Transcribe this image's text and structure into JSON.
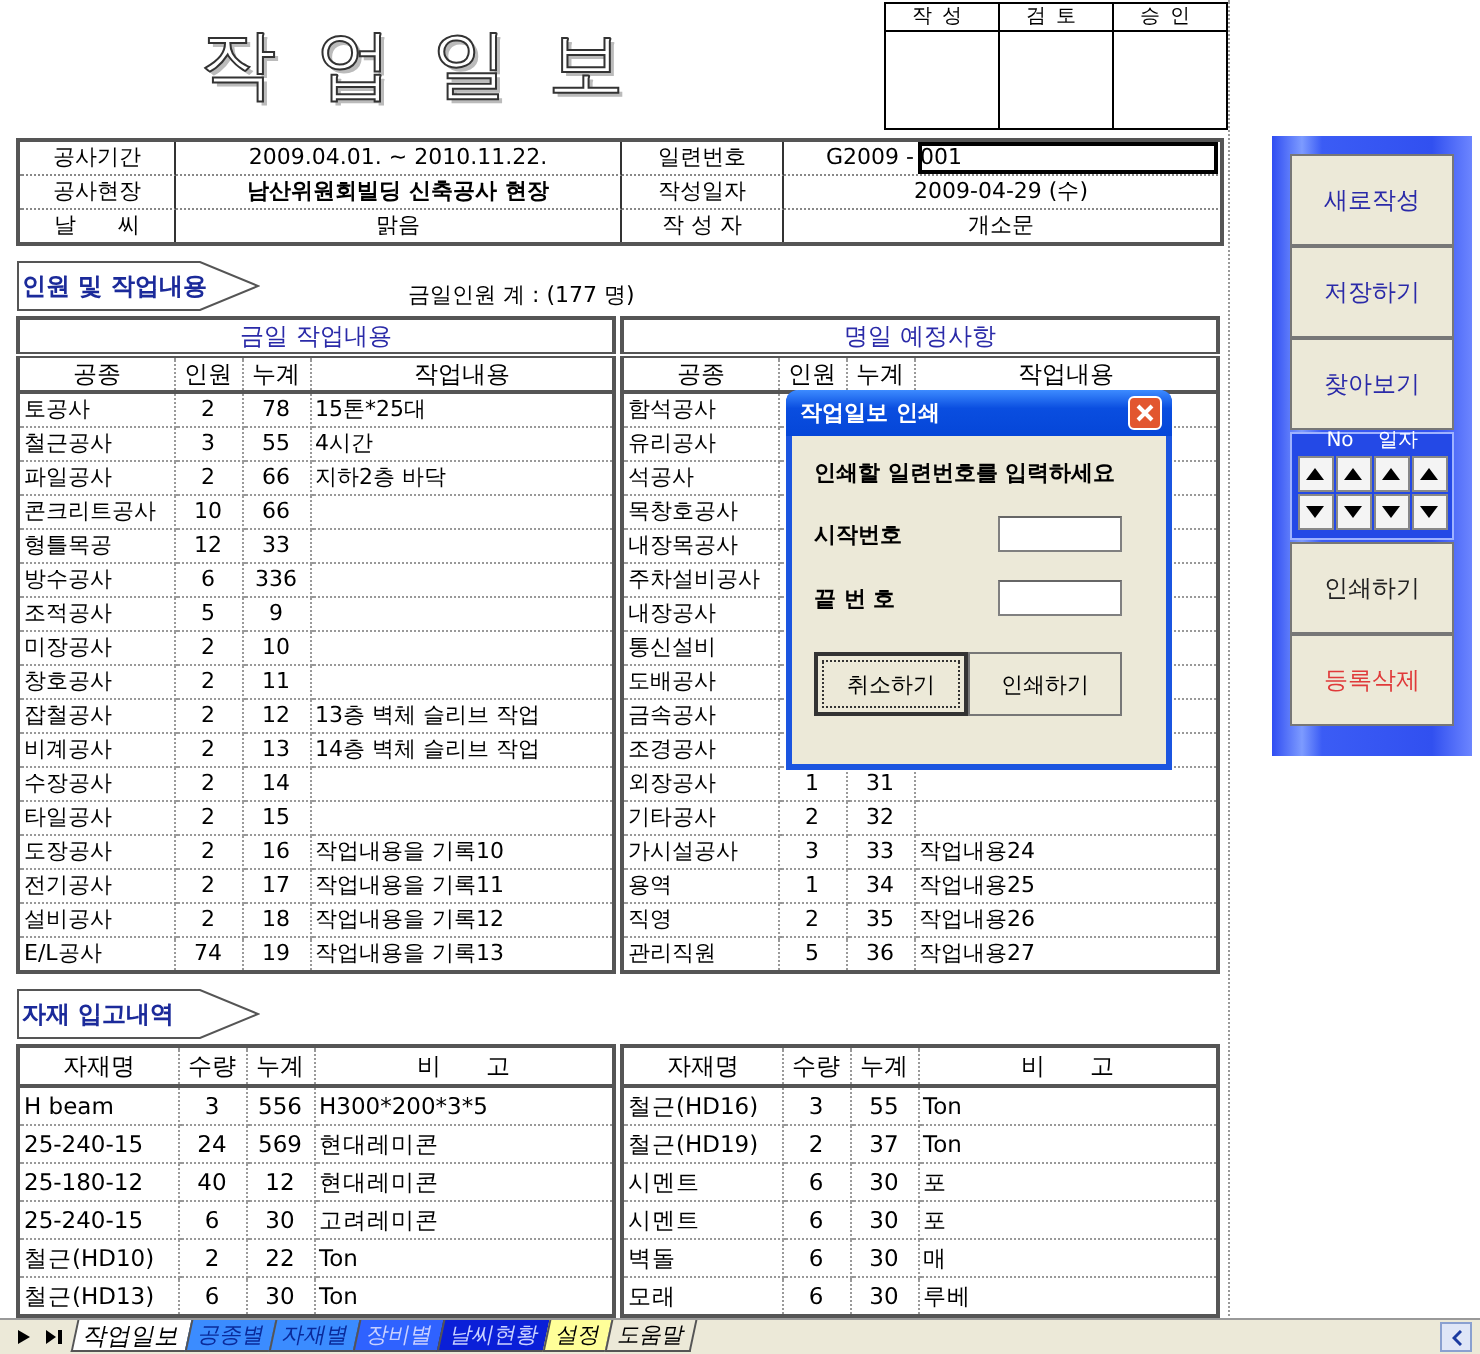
{
  "title": "작업일보",
  "approval": [
    "작성",
    "검토",
    "승인"
  ],
  "info_left": [
    {
      "label": "공사기간",
      "value": "2009.04.01. ~ 2010.11.22.",
      "bold": false
    },
    {
      "label": "공사현장",
      "value": "남산위원회빌딩 신축공사 현장",
      "bold": true
    },
    {
      "label": "날      씨",
      "value": "맑음",
      "bold": false
    }
  ],
  "info_right": [
    {
      "label": "일련번호",
      "prefix": "G2009 -",
      "value": "001",
      "selected": true
    },
    {
      "label": "작성일자",
      "value": "2009-04-29 (수)",
      "selected": false
    },
    {
      "label": "작 성 자",
      "value": "개소문",
      "selected": false
    }
  ],
  "work": {
    "banner": "인원 및 작업내용",
    "total": "금일인원 계 : (177 명)",
    "tables": [
      {
        "title": "금일 작업내용",
        "columns": [
          "공종",
          "인원",
          "누계",
          "작업내용"
        ],
        "rows": [
          [
            "토공사",
            "2",
            "78",
            "15톤*25대"
          ],
          [
            "철근공사",
            "3",
            "55",
            "4시간"
          ],
          [
            "파일공사",
            "2",
            "66",
            "지하2층 바닥"
          ],
          [
            "콘크리트공사",
            "10",
            "66"
          ],
          [
            "형틀목공",
            "12",
            "33"
          ],
          [
            "방수공사",
            "6",
            "336"
          ],
          [
            "조적공사",
            "5",
            "9"
          ],
          [
            "미장공사",
            "2",
            "10"
          ],
          [
            "창호공사",
            "2",
            "11"
          ],
          [
            "잡철공사",
            "2",
            "12",
            "13층 벽체 슬리브 작업"
          ],
          [
            "비계공사",
            "2",
            "13",
            "14층 벽체 슬리브 작업"
          ],
          [
            "수장공사",
            "2",
            "14"
          ],
          [
            "타일공사",
            "2",
            "15"
          ],
          [
            "도장공사",
            "2",
            "16",
            "작업내용을 기록10"
          ],
          [
            "전기공사",
            "2",
            "17",
            "작업내용을 기록11"
          ],
          [
            "설비공사",
            "2",
            "18",
            "작업내용을 기록12"
          ],
          [
            "E/L공사",
            "74",
            "19",
            "작업내용을 기록13"
          ]
        ]
      },
      {
        "title": "명일 예정사항",
        "columns": [
          "공종",
          "인원",
          "누계",
          "작업내용"
        ],
        "rows": [
          [
            "함석공사"
          ],
          [
            "유리공사"
          ],
          [
            "석공사"
          ],
          [
            "목창호공사"
          ],
          [
            "내장목공사"
          ],
          [
            "주차설비공사"
          ],
          [
            "내장공사"
          ],
          [
            "통신설비"
          ],
          [
            "도배공사"
          ],
          [
            "금속공사"
          ],
          [
            "조경공사"
          ],
          [
            "외장공사",
            "1",
            "31"
          ],
          [
            "기타공사",
            "2",
            "32"
          ],
          [
            "가시설공사",
            "3",
            "33",
            "작업내용24"
          ],
          [
            "용역",
            "1",
            "34",
            "작업내용25"
          ],
          [
            "직영",
            "2",
            "35",
            "작업내용26"
          ],
          [
            "관리직원",
            "5",
            "36",
            "작업내용27"
          ]
        ]
      }
    ]
  },
  "materials": {
    "banner": "자재 입고내역",
    "tables": [
      {
        "columns": [
          "자재명",
          "수량",
          "누계",
          "비      고"
        ],
        "rows": [
          [
            "H beam",
            "3",
            "556",
            "H300*200*3*5"
          ],
          [
            "25-240-15",
            "24",
            "569",
            "현대레미콘"
          ],
          [
            "25-180-12",
            "40",
            "12",
            "현대레미콘"
          ],
          [
            "25-240-15",
            "6",
            "30",
            "고려레미콘"
          ],
          [
            "철근(HD10)",
            "2",
            "22",
            "Ton"
          ],
          [
            "철근(HD13)",
            "6",
            "30",
            "Ton"
          ]
        ]
      },
      {
        "columns": [
          "자재명",
          "수량",
          "누계",
          "비      고"
        ],
        "rows": [
          [
            "철근(HD16)",
            "3",
            "55",
            "Ton"
          ],
          [
            "철근(HD19)",
            "2",
            "37",
            "Ton"
          ],
          [
            "시멘트",
            "6",
            "30",
            "포"
          ],
          [
            "시멘트",
            "6",
            "30",
            "포"
          ],
          [
            "벽돌",
            "6",
            "30",
            "매"
          ],
          [
            "모래",
            "6",
            "30",
            "루베"
          ]
        ]
      }
    ]
  },
  "dialog": {
    "title": "작업일보 인쇄",
    "prompt": "인쇄할 일련번호를 입력하세요",
    "fields": [
      {
        "label": "시작번호"
      },
      {
        "label": "끝 번 호"
      }
    ],
    "buttons": [
      {
        "label": "취소하기",
        "focused": true
      },
      {
        "label": "인쇄하기",
        "focused": false
      }
    ]
  },
  "side_panel": [
    {
      "kind": "button",
      "label": "새로작성",
      "color": "#2a2aa8"
    },
    {
      "kind": "button",
      "label": "저장하기",
      "color": "#2a2aa8"
    },
    {
      "kind": "button",
      "label": "찾아보기",
      "color": "#2a2aa8"
    },
    {
      "kind": "spinner",
      "labels": [
        "No",
        "일자"
      ]
    },
    {
      "kind": "button",
      "label": "인쇄하기",
      "color": "#222222"
    },
    {
      "kind": "button",
      "label": "등록삭제",
      "color": "#e03a3a"
    }
  ],
  "sheet_tabs": [
    {
      "label": "작업일보",
      "selected": true,
      "color": "#ffffff"
    },
    {
      "label": "공종별",
      "selected": false,
      "color": "#3b8cff"
    },
    {
      "label": "자재별",
      "selected": false,
      "color": "#3b8cff"
    },
    {
      "label": "장비별",
      "selected": false,
      "color": "#2f62ff"
    },
    {
      "label": "날씨현황",
      "selected": false,
      "color": "#0a1fd8"
    },
    {
      "label": "설정",
      "selected": false,
      "color": "#ffff99"
    },
    {
      "label": "도움말",
      "selected": false,
      "color": "#ece9d8"
    }
  ]
}
